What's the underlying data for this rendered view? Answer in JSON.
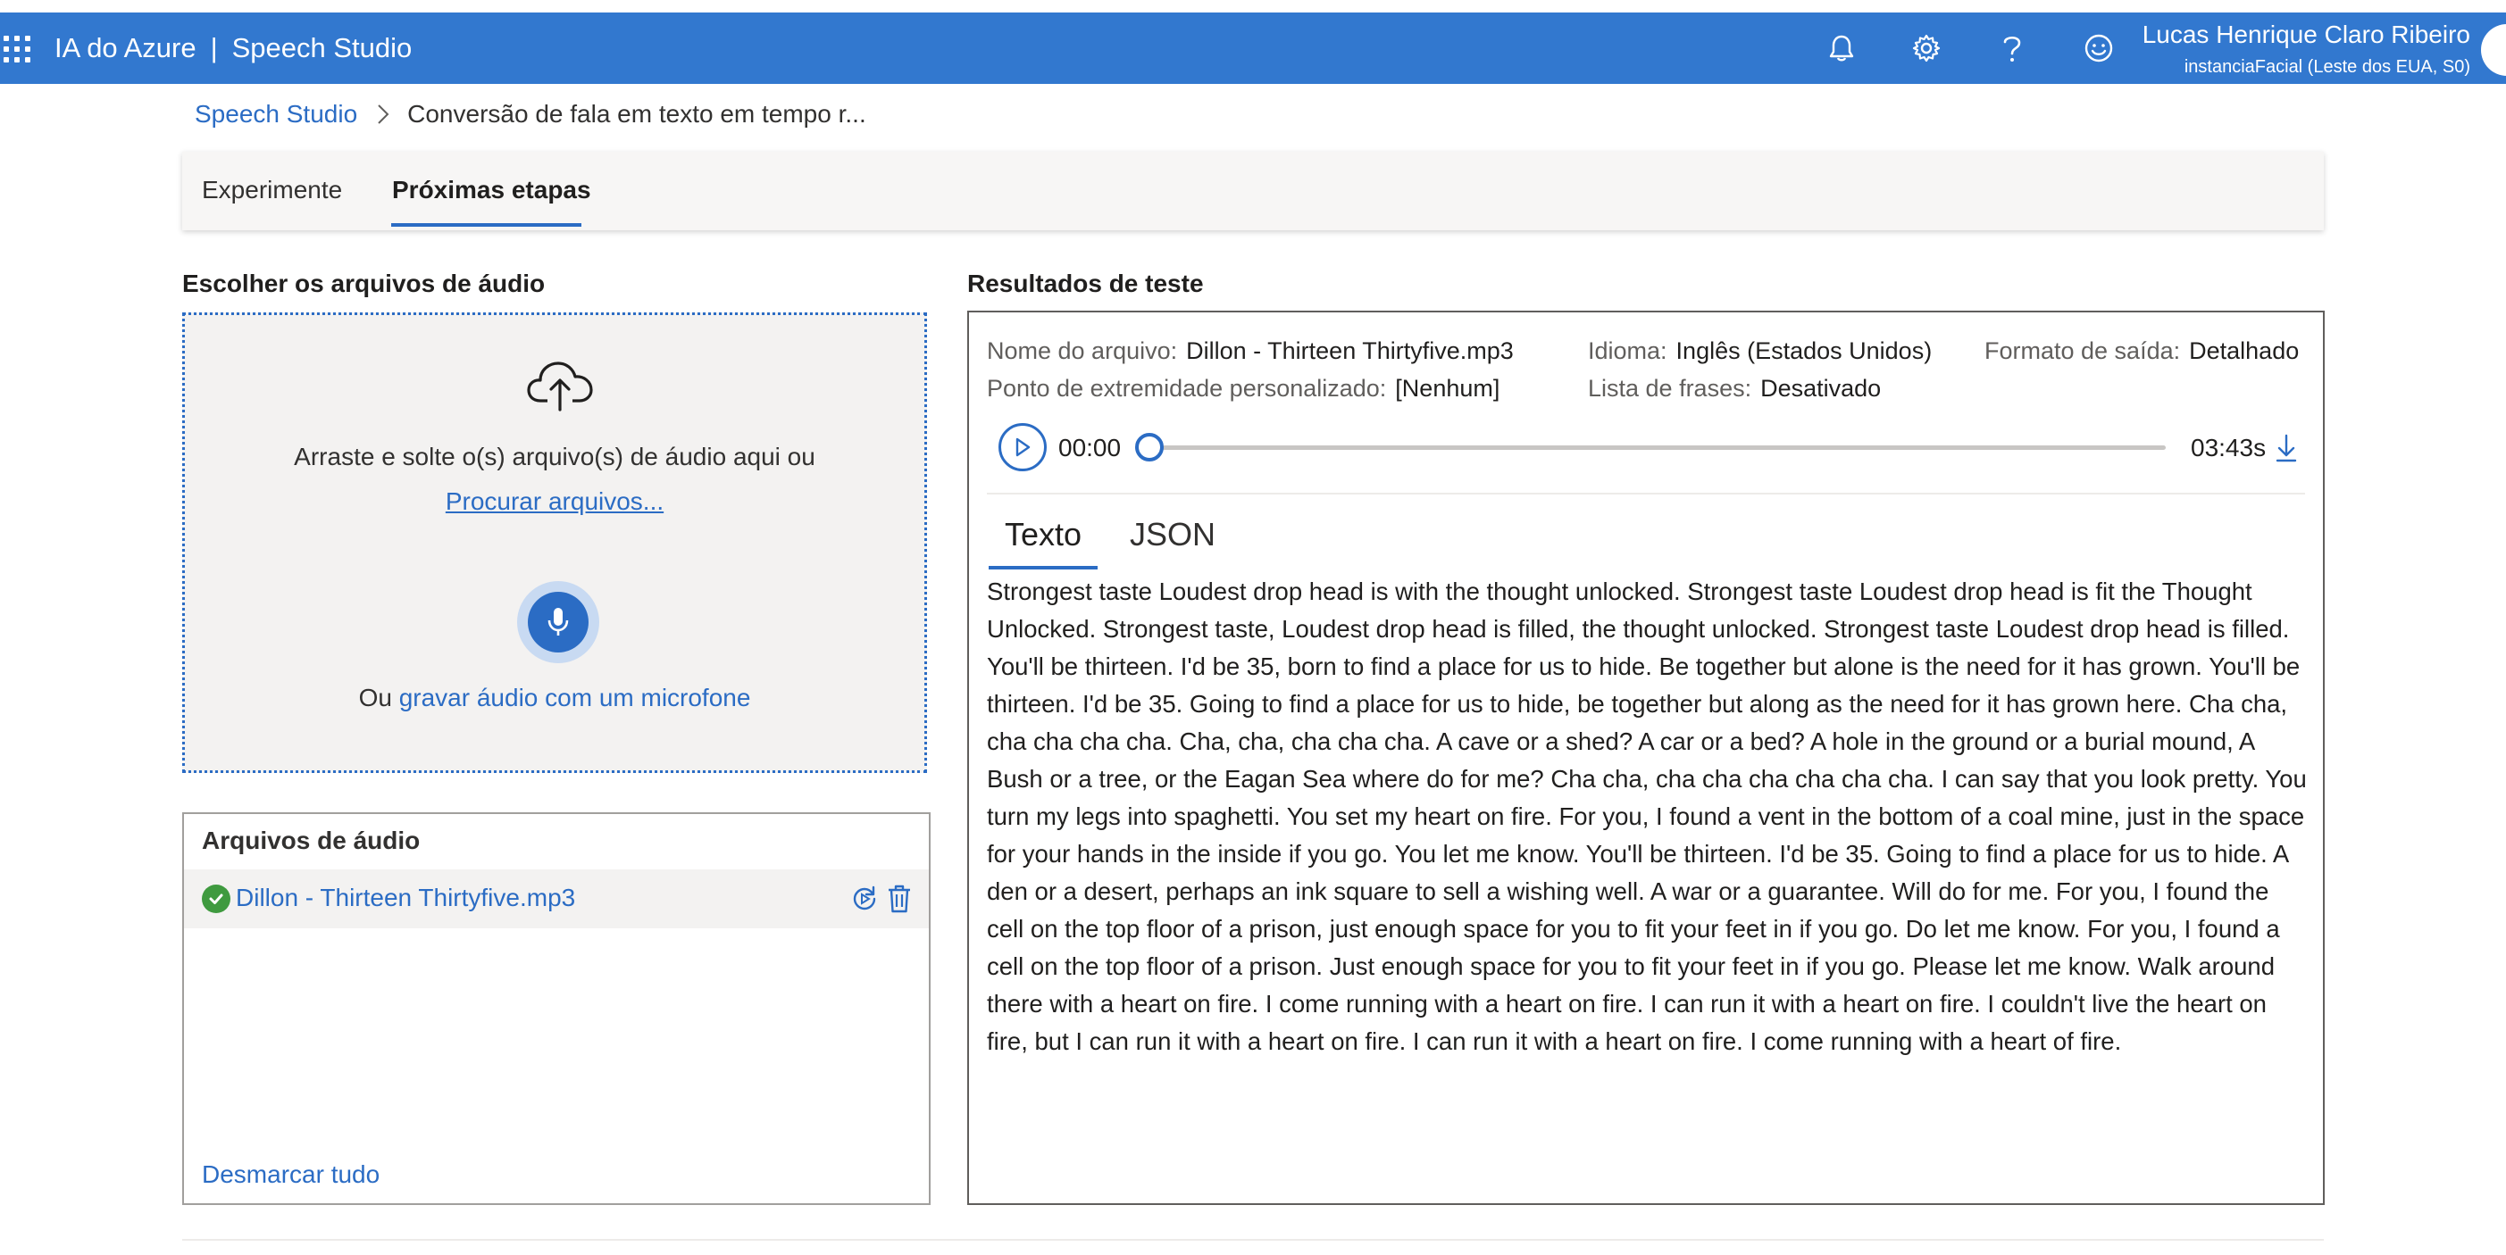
{
  "topbar": {
    "product": "IA do Azure",
    "separator": "|",
    "app": "Speech Studio",
    "user_name": "Lucas Henrique Claro Ribeiro",
    "user_sub": "instanciaFacial (Leste dos EUA, S0)",
    "icons": [
      "bell-icon",
      "gear-icon",
      "help-icon",
      "feedback-smiley-icon"
    ]
  },
  "breadcrumb": {
    "root": "Speech Studio",
    "current": "Conversão de fala em texto em tempo r..."
  },
  "tabs": [
    {
      "label": "Experimente",
      "selected": false
    },
    {
      "label": "Próximas etapas",
      "selected": true
    }
  ],
  "upload": {
    "title": "Escolher os arquivos de áudio",
    "drop_text": "Arraste e solte o(s) arquivo(s) de áudio aqui ou",
    "browse_link": "Procurar arquivos...",
    "mic_prefix": "Ou",
    "mic_link": "gravar áudio com um microfone"
  },
  "files": {
    "title": "Arquivos de áudio",
    "items": [
      {
        "name": "Dillon - Thirteen Thirtyfive.mp3",
        "status": "success"
      }
    ],
    "unselect_all": "Desmarcar tudo"
  },
  "results": {
    "title": "Resultados de teste",
    "meta": {
      "file_label": "Nome do arquivo:",
      "file_value": "Dillon - Thirteen Thirtyfive.mp3",
      "language_label": "Idioma:",
      "language_value": "Inglês (Estados Unidos)",
      "format_label": "Formato de saída:",
      "format_value": "Detalhado",
      "endpoint_label": "Ponto de extremidade personalizado:",
      "endpoint_value": "[Nenhum]",
      "phrases_label": "Lista de frases:",
      "phrases_value": "Desativado"
    },
    "player": {
      "current_time": "00:00",
      "total_time": "03:43s",
      "progress": 0
    },
    "tabs": [
      {
        "label": "Texto",
        "selected": true
      },
      {
        "label": "JSON",
        "selected": false
      }
    ],
    "transcript": "Strongest taste Loudest drop head is with the thought unlocked. Strongest taste Loudest drop head is fit the Thought Unlocked. Strongest taste, Loudest drop head is filled, the thought unlocked. Strongest taste Loudest drop head is filled. You'll be thirteen. I'd be 35, born to find a place for us to hide. Be together but alone is the need for it has grown. You'll be thirteen. I'd be 35. Going to find a place for us to hide, be together but along as the need for it has grown here. Cha cha, cha cha cha cha. Cha, cha, cha cha cha. A cave or a shed? A car or a bed? A hole in the ground or a burial mound, A Bush or a tree, or the Eagan Sea where do for me? Cha cha, cha cha cha cha cha cha. I can say that you look pretty. You turn my legs into spaghetti. You set my heart on fire. For you, I found a vent in the bottom of a coal mine, just in the space for your hands in the inside if you go. You let me know. You'll be thirteen. I'd be 35. Going to find a place for us to hide. A den or a desert, perhaps an ink square to sell a wishing well. A war or a guarantee. Will do for me. For you, I found the cell on the top floor of a prison, just enough space for you to fit your feet in if you go. Do let me know. For you, I found a cell on the top floor of a prison. Just enough space for you to fit your feet in if you go. Please let me know. Walk around there with a heart on fire. I come running with a heart on fire. I can run it with a heart on fire. I couldn't live the heart on fire, but I can run it with a heart on fire. I can run it with a heart on fire. I come running with a heart of fire."
  },
  "colors": {
    "topbar": "#3278cf",
    "accent": "#2b6cc4",
    "success": "#3f9a3f"
  }
}
